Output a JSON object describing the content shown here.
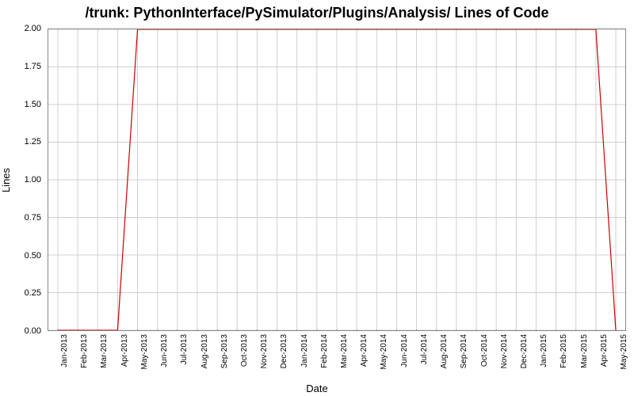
{
  "chart_data": {
    "type": "line",
    "title": "/trunk: PythonInterface/PySimulator/Plugins/Analysis/ Lines of Code",
    "xlabel": "Date",
    "ylabel": "Lines",
    "ylim": [
      0.0,
      2.0
    ],
    "y_ticks": [
      "0.00",
      "0.25",
      "0.50",
      "0.75",
      "1.00",
      "1.25",
      "1.50",
      "1.75",
      "2.00"
    ],
    "categories": [
      "Jan-2013",
      "Feb-2013",
      "Mar-2013",
      "Apr-2013",
      "May-2013",
      "Jun-2013",
      "Jul-2013",
      "Aug-2013",
      "Sep-2013",
      "Oct-2013",
      "Nov-2013",
      "Dec-2013",
      "Jan-2014",
      "Feb-2014",
      "Mar-2014",
      "Apr-2014",
      "May-2014",
      "Jun-2014",
      "Jul-2014",
      "Aug-2014",
      "Sep-2014",
      "Oct-2014",
      "Nov-2014",
      "Dec-2014",
      "Jan-2015",
      "Feb-2015",
      "Mar-2015",
      "Apr-2015",
      "May-2015"
    ],
    "series": [
      {
        "name": "Lines of Code",
        "color": "#cc0000",
        "values": [
          0,
          0,
          0,
          0,
          2,
          2,
          2,
          2,
          2,
          2,
          2,
          2,
          2,
          2,
          2,
          2,
          2,
          2,
          2,
          2,
          2,
          2,
          2,
          2,
          2,
          2,
          2,
          2,
          0
        ]
      }
    ]
  }
}
